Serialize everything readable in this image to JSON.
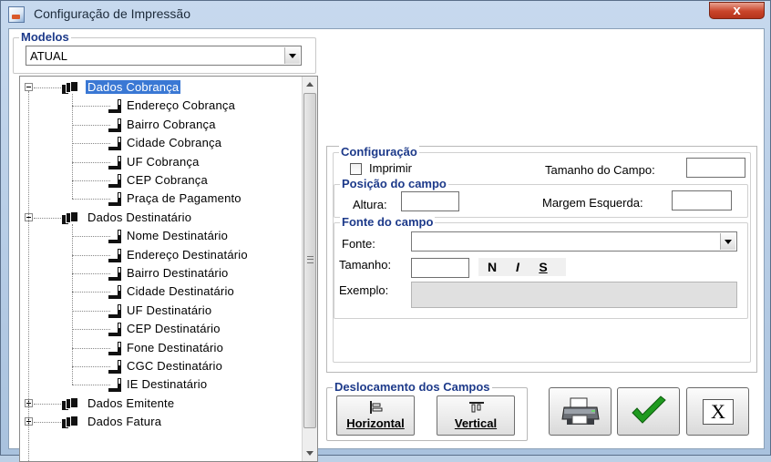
{
  "window": {
    "title": "Configuração de Impressão",
    "close_label": "x",
    "app_icon": "print-settings-icon"
  },
  "models": {
    "legend": "Modelos",
    "selected": "ATUAL"
  },
  "tree": {
    "groups": [
      {
        "label": "Dados Cobrança",
        "expanded": true,
        "selected": true,
        "children": [
          "Endereço Cobrança",
          "Bairro Cobrança",
          "Cidade Cobrança",
          "UF Cobrança",
          "CEP Cobrança",
          "Praça de Pagamento"
        ]
      },
      {
        "label": "Dados Destinatário",
        "expanded": true,
        "selected": false,
        "children": [
          "Nome Destinatário",
          "Endereço Destinatário",
          "Bairro Destinatário",
          "Cidade Destinatário",
          "UF Destinatário",
          "CEP Destinatário",
          "Fone Destinatário",
          "CGC Destinatário",
          "IE Destinatário"
        ]
      },
      {
        "label": "Dados Emitente",
        "expanded": false,
        "selected": false,
        "children": []
      },
      {
        "label": "Dados Fatura",
        "expanded": false,
        "selected": false,
        "children": []
      }
    ]
  },
  "config": {
    "legend": "Configuração",
    "print_label": "Imprimir",
    "print_checked": false,
    "field_size_label": "Tamanho do Campo:",
    "field_size_value": "",
    "position": {
      "legend": "Posição do campo",
      "height_label": "Altura:",
      "height_value": "",
      "left_margin_label": "Margem Esquerda:",
      "left_margin_value": ""
    },
    "font": {
      "legend": "Fonte do campo",
      "font_label": "Fonte:",
      "font_value": "",
      "size_label": "Tamanho:",
      "size_value": "",
      "bold": "N",
      "italic": "I",
      "underline": "S",
      "example_label": "Exemplo:"
    }
  },
  "shift": {
    "legend": "Deslocamento dos Campos",
    "horizontal": "Horizontal",
    "vertical": "Vertical"
  },
  "actions": {
    "print_icon": "printer-icon",
    "ok_icon": "checkmark-icon",
    "cancel_label": "X"
  },
  "colors": {
    "legend_text": "#1d3a8a",
    "selection": "#3a78d4",
    "check_green": "#1f9a1f"
  }
}
